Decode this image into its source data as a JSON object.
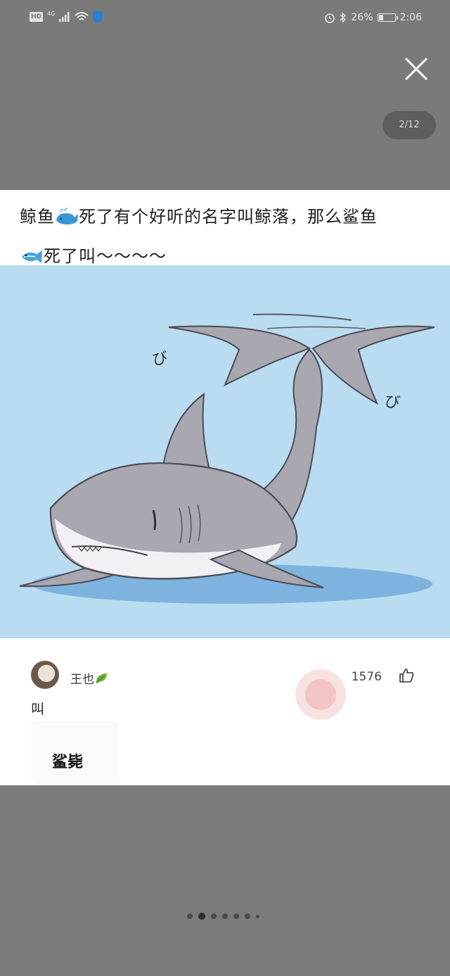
{
  "status_bar": {
    "hd": "HD",
    "network": "4G",
    "battery": "26%",
    "battery_level": 0.26,
    "time": "2:06",
    "icons": [
      "signal-icon",
      "wifi-icon",
      "shield-icon",
      "alarm-icon",
      "bluetooth-icon",
      "battery-icon"
    ]
  },
  "viewer": {
    "page_indicator": "2/12",
    "close_icon": "close-icon",
    "dots_count": 7,
    "active_dot": 1
  },
  "post": {
    "title_part1": "鲸鱼",
    "title_part2": "死了有个好听的名字叫鲸落，那么鲨鱼",
    "title_part3": "死了叫～～～～",
    "emoji1": "whale-emoji",
    "emoji2": "fish-emoji",
    "image_text_1": "び",
    "image_text_2": "び"
  },
  "comment": {
    "username": "王也",
    "badge_icon": "leaf-icon",
    "likes": "1576",
    "text": "叫",
    "answer": "鲨毙"
  },
  "colors": {
    "overlay": "#7a7a7a",
    "image_bg": "#b9dcf0",
    "shark_body": "#a9a9b0",
    "shark_belly": "#f2f0f4"
  }
}
